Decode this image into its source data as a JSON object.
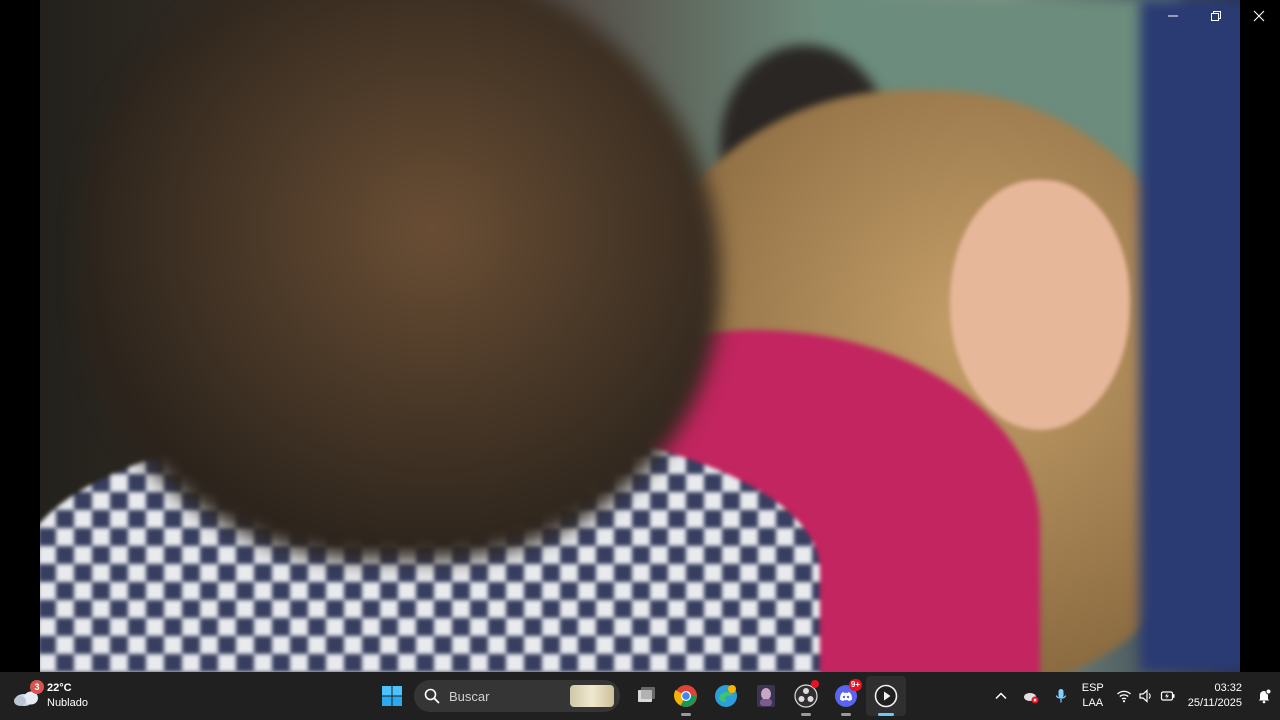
{
  "taskbar": {
    "weather": {
      "badge": "3",
      "temperature": "22°C",
      "condition": "Nublado",
      "icon": "cloudy-icon"
    },
    "search": {
      "placeholder": "Buscar"
    },
    "apps": [
      {
        "name": "start",
        "icon": "windows-logo-icon"
      },
      {
        "name": "task-view",
        "icon": "task-view-icon"
      },
      {
        "name": "chrome",
        "icon": "chrome-icon"
      },
      {
        "name": "microsoft-edge-beta",
        "icon": "edge-icon"
      },
      {
        "name": "photo-app",
        "icon": "photo-icon"
      },
      {
        "name": "obs",
        "icon": "obs-icon"
      },
      {
        "name": "discord",
        "icon": "discord-icon",
        "badge": "9+"
      },
      {
        "name": "media-player",
        "icon": "media-player-icon"
      }
    ],
    "tray": {
      "language_top": "ESP",
      "language_bottom": "LAA",
      "time": "03:32",
      "date": "25/11/2025"
    }
  },
  "colors": {
    "accent": "#60cdff",
    "taskbar": "#202020",
    "badge_red": "#e81123"
  }
}
